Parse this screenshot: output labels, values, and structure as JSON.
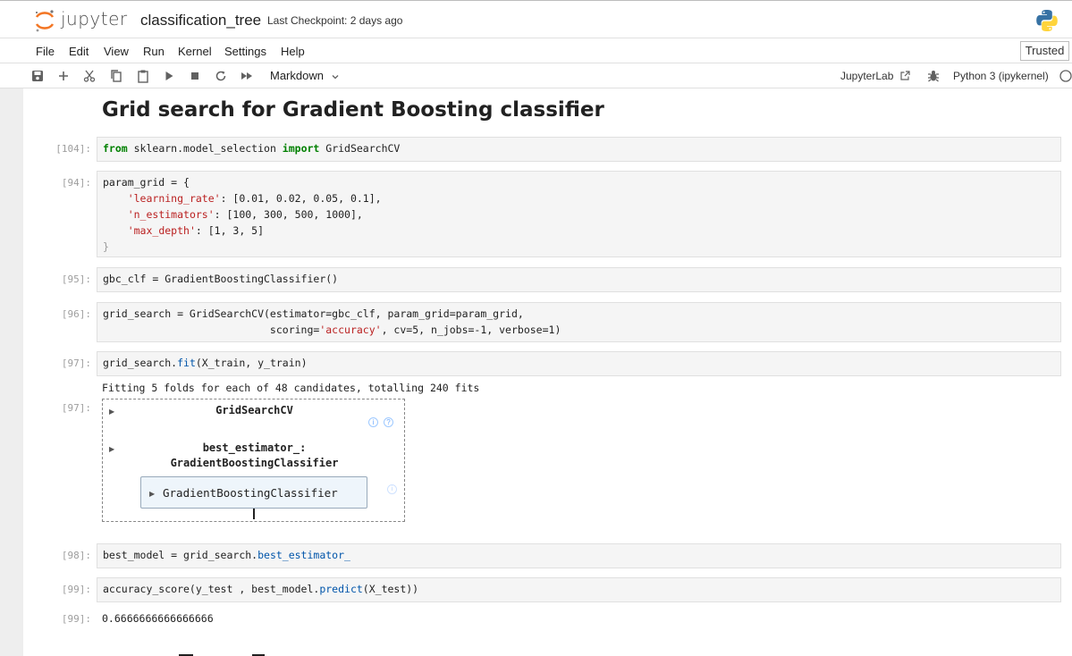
{
  "header": {
    "brand": "jupyter",
    "notebook_title": "classification_tree",
    "checkpoint": "Last Checkpoint: 2 days ago"
  },
  "menubar": {
    "items": [
      "File",
      "Edit",
      "View",
      "Run",
      "Kernel",
      "Settings",
      "Help"
    ],
    "trusted": "Trusted"
  },
  "toolbar": {
    "icons": [
      "save-icon",
      "add-cell-icon",
      "cut-icon",
      "copy-icon",
      "paste-icon",
      "run-icon",
      "stop-icon",
      "restart-icon",
      "fast-forward-icon"
    ],
    "cell_type": "Markdown",
    "jupyterlab_link": "JupyterLab",
    "kernel": "Python 3 (ipykernel)"
  },
  "notebook": {
    "heading": "Grid search for Gradient Boosting classifier",
    "cells": {
      "c104": {
        "prompt": "[104]:",
        "code": {
          "kw1": "from",
          "mod": " sklearn.model_selection ",
          "kw2": "import",
          "name": " GridSearchCV"
        }
      },
      "c94": {
        "prompt": "[94]:",
        "l1": "param_grid = {",
        "k1": "'learning_rate'",
        "v1": ": [0.01, 0.02, 0.05, 0.1],",
        "k2": "'n_estimators'",
        "v2": ": [100, 300, 500, 1000],",
        "k3": "'max_depth'",
        "v3": ": [1, 3, 5]",
        "close": "}"
      },
      "c95": {
        "prompt": "[95]:",
        "code": "gbc_clf = GradientBoostingClassifier()"
      },
      "c96": {
        "prompt": "[96]:",
        "line1": "grid_search = GridSearchCV(estimator=gbc_clf, param_grid=param_grid,",
        "line2_pre": "                           scoring=",
        "line2_str": "'accuracy'",
        "line2_post": ", cv=5, n_jobs=-1, verbose=1)"
      },
      "c97": {
        "prompt": "[97]:",
        "code_pre": "grid_search.",
        "code_fn": "fit",
        "code_post": "(X_train, y_train)",
        "stream": "Fitting 5 folds for each of 48 candidates, totalling 240 fits",
        "out_prompt": "[97]:",
        "widget": {
          "title": "GridSearchCV",
          "info": "i",
          "help": "?",
          "best_estimator_line1": "best_estimator_:",
          "best_estimator_line2": "GradientBoostingClassifier",
          "estimator": "GradientBoostingClassifier",
          "estimator_info": "i"
        }
      },
      "c98": {
        "prompt": "[98]:",
        "code_pre": "best_model = grid_search.",
        "code_attr": "best_estimator_"
      },
      "c99": {
        "prompt": "[99]:",
        "code_pre": "accuracy_score(y_test , best_model.",
        "code_fn": "predict",
        "code_post": "(X_test))",
        "out_prompt": "[99]:",
        "output": "0.6666666666666666"
      }
    }
  }
}
